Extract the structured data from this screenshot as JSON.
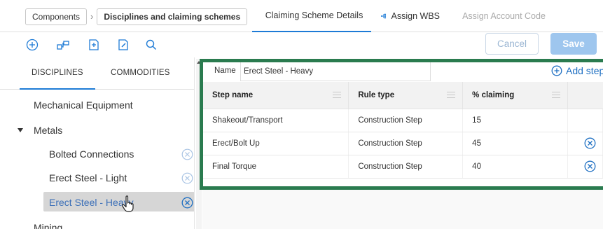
{
  "breadcrumb": [
    "Components",
    "Disciplines and claiming schemes"
  ],
  "tabs": [
    {
      "label": "Claiming Scheme Details",
      "icon": "edit-icon",
      "active": true
    },
    {
      "label": "Assign WBS",
      "icon": "hierarchy-icon",
      "active": false
    },
    {
      "label": "Assign Account Code",
      "icon": "barcode-icon",
      "disabled": true
    }
  ],
  "toolbar": {
    "icons": [
      "add-circle-icon",
      "tree-add-icon",
      "document-add-icon",
      "document-edit-icon",
      "search-icon"
    ],
    "cancel_label": "Cancel",
    "save_label": "Save"
  },
  "left": {
    "tabs": [
      "DISCIPLINES",
      "COMMODITIES"
    ],
    "items": [
      {
        "label": "Mechanical Equipment",
        "level": 0
      },
      {
        "label": "Metals",
        "level": 0,
        "expanded": true
      },
      {
        "label": "Bolted Connections",
        "level": 1
      },
      {
        "label": "Erect Steel - Light",
        "level": 1
      },
      {
        "label": "Erect Steel - Heavy",
        "level": 1,
        "selected": true
      },
      {
        "label": "Mining",
        "level": 0
      }
    ]
  },
  "right": {
    "name_label": "Name",
    "name_value": "Erect Steel - Heavy",
    "add_step_label": "Add step",
    "columns": [
      "Step name",
      "Rule type",
      "% claiming",
      ""
    ],
    "rows": [
      {
        "step": "Shakeout/Transport",
        "rule": "Construction Step",
        "claiming": "15",
        "removable": false
      },
      {
        "step": "Erect/Bolt Up",
        "rule": "Construction Step",
        "claiming": "45",
        "removable": true
      },
      {
        "step": "Final Torque",
        "rule": "Construction Step",
        "claiming": "40",
        "removable": true
      }
    ]
  },
  "colors": {
    "accent": "#1e7bd6",
    "frame": "#2a7b4f",
    "save_bg": "#9ec6ee"
  }
}
